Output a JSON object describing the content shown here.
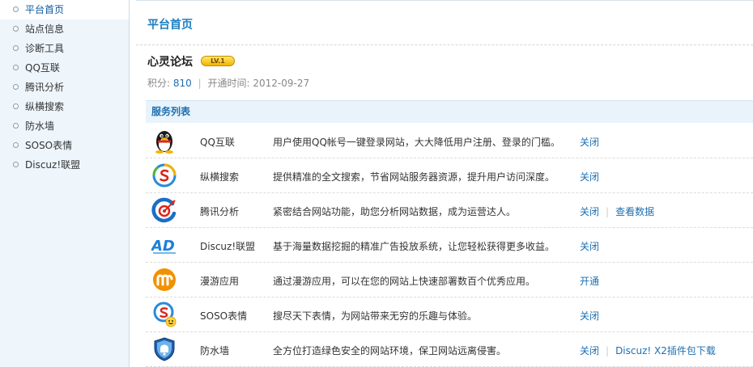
{
  "sidebar": {
    "items": [
      {
        "label": "平台首页",
        "active": true
      },
      {
        "label": "站点信息"
      },
      {
        "label": "诊断工具"
      },
      {
        "label": "QQ互联"
      },
      {
        "label": "腾讯分析"
      },
      {
        "label": "纵横搜索"
      },
      {
        "label": "防水墙"
      },
      {
        "label": "SOSO表情"
      },
      {
        "label": "Discuz!联盟"
      }
    ]
  },
  "main": {
    "title": "平台首页",
    "site": {
      "name": "心灵论坛",
      "level_badge": "LV.1",
      "points_label": "积分:",
      "points_value": "810",
      "opened_label": "开通时间:",
      "opened_value": "2012-09-27"
    },
    "services_header": "服务列表",
    "services": [
      {
        "icon": "qq-penguin-icon",
        "name": "QQ互联",
        "desc": "用户使用QQ帐号一键登录网站，大大降低用户注册、登录的门槛。",
        "actions": [
          "关闭"
        ]
      },
      {
        "icon": "soso-search-icon",
        "name": "纵横搜索",
        "desc": "提供精准的全文搜索，节省网站服务器资源，提升用户访问深度。",
        "actions": [
          "关闭"
        ]
      },
      {
        "icon": "tencent-analytics-icon",
        "name": "腾讯分析",
        "desc": "紧密结合网站功能，助您分析网站数据，成为运营达人。",
        "actions": [
          "关闭",
          "查看数据"
        ]
      },
      {
        "icon": "discuz-ad-icon",
        "name": "Discuz!联盟",
        "desc": "基于海量数据挖掘的精准广告投放系统，让您轻松获得更多收益。",
        "actions": [
          "关闭"
        ]
      },
      {
        "icon": "manyou-icon",
        "name": "漫游应用",
        "desc": "通过漫游应用，可以在您的网站上快速部署数百个优秀应用。",
        "actions": [
          "开通"
        ]
      },
      {
        "icon": "soso-emoticon-icon",
        "name": "SOSO表情",
        "desc": "搜尽天下表情，为网站带来无穷的乐趣与体验。",
        "actions": [
          "关闭"
        ]
      },
      {
        "icon": "firewall-shield-icon",
        "name": "防水墙",
        "desc": "全方位打造绿色安全的网站环境，保卫网站远离侵害。",
        "actions": [
          "关闭",
          "Discuz! X2插件包下载"
        ]
      }
    ]
  }
}
